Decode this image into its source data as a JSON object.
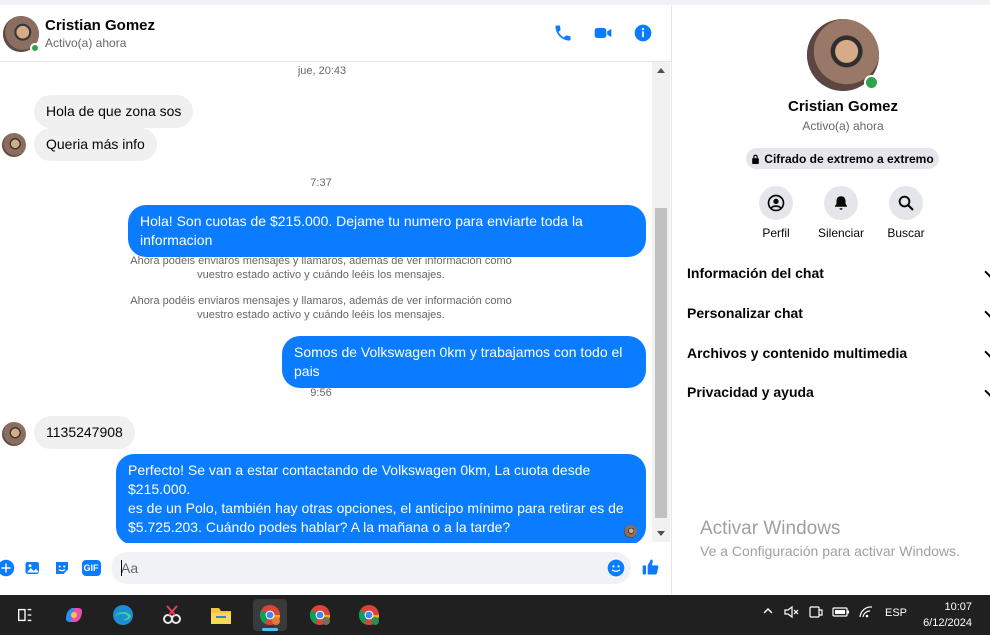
{
  "header": {
    "name": "Cristian Gomez",
    "status": "Activo(a) ahora"
  },
  "messages": {
    "ts1": "jue, 20:43",
    "m1": "Hola de que zona sos",
    "m2": "Queria más info",
    "ts2": "7:37",
    "m3": "Hola! Son cuotas de $215.000. Dejame tu numero para enviarte toda la informacion",
    "sys1_l1": "Ahora podéis enviaros mensajes y llamaros, además de ver información como",
    "sys1_l2": "vuestro estado activo y cuándo leéis los mensajes.",
    "sys2_l1": "Ahora podéis enviaros mensajes y llamaros, además de ver información como",
    "sys2_l2": "vuestro estado activo y cuándo leéis los mensajes.",
    "m4": "Somos de Volkswagen 0km y trabajamos con todo el pais",
    "ts3": "9:56",
    "m5": "1135247908",
    "m6_l1": "Perfecto!  Se van a estar contactando de Volkswagen 0km, La cuota desde $215.000.",
    "m6_l2": "es de un Polo, también hay otras opciones, el anticipo mínimo para retirar es de",
    "m6_l3": "$5.725.203. Cuándo podes hablar? A la mañana o a la tarde?"
  },
  "composer": {
    "placeholder": "Aa",
    "gif_label": "GIF"
  },
  "profile": {
    "name": "Cristian Gomez",
    "status": "Activo(a) ahora",
    "e2e_label": "Cifrado de extremo a extremo",
    "actions": [
      {
        "label": "Perfil",
        "icon": "profile-icon"
      },
      {
        "label": "Silenciar",
        "icon": "bell-icon"
      },
      {
        "label": "Buscar",
        "icon": "search-icon"
      }
    ],
    "sections": [
      {
        "label": "Información del chat"
      },
      {
        "label": "Personalizar chat"
      },
      {
        "label": "Archivos y contenido multimedia"
      },
      {
        "label": "Privacidad y ayuda"
      }
    ]
  },
  "watermark": {
    "title": "Activar Windows",
    "subtitle": "Ve a Configuración para activar Windows."
  },
  "taskbar": {
    "language": "ESP",
    "time": "10:07",
    "date": "6/12/2024"
  },
  "colors": {
    "accent": "#0a7cff",
    "online": "#31a24c",
    "taskbar": "#202020"
  }
}
